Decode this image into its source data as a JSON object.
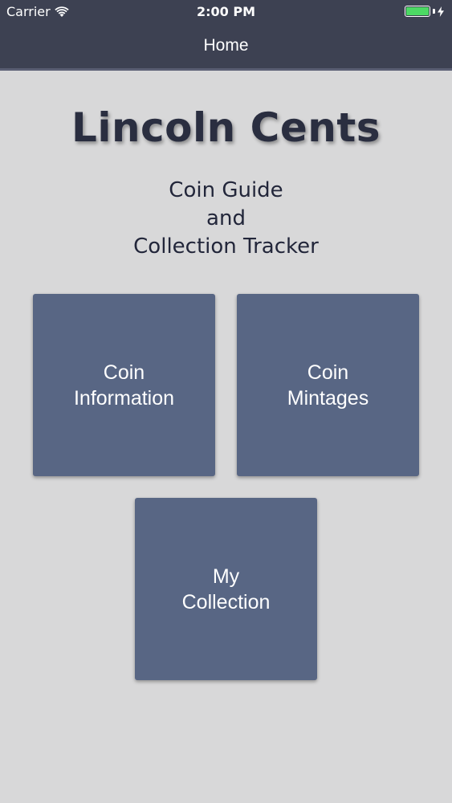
{
  "status_bar": {
    "carrier": "Carrier",
    "time": "2:00 PM",
    "battery_level": 1.0,
    "battery_color": "#4cd964"
  },
  "nav": {
    "title": "Home"
  },
  "main": {
    "title": "Lincoln Cents",
    "subtitle_lines": [
      "Coin Guide",
      "and",
      "Collection Tracker"
    ]
  },
  "tiles": [
    {
      "line1": "Coin",
      "line2": "Information"
    },
    {
      "line1": "Coin",
      "line2": "Mintages"
    },
    {
      "line1": "My",
      "line2": "Collection"
    }
  ],
  "colors": {
    "header_bg": "#3d4152",
    "page_bg": "#d8d8d9",
    "tile_bg": "#586684",
    "title_text": "#2a2e40"
  },
  "icons": [
    "wifi-icon",
    "battery-icon",
    "charging-bolt-icon"
  ]
}
